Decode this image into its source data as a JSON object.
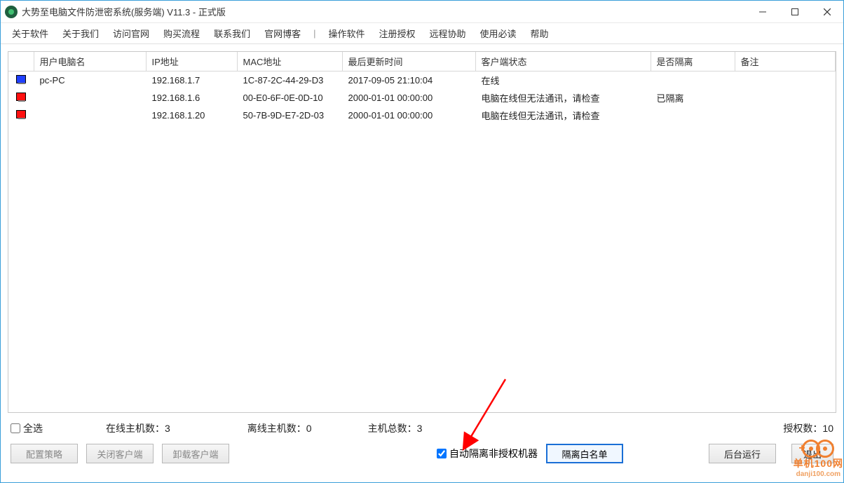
{
  "window": {
    "title": "大势至电脑文件防泄密系统(服务端) V11.3 - 正式版"
  },
  "menu": {
    "items_left": [
      "关于软件",
      "关于我们",
      "访问官网",
      "购买流程",
      "联系我们",
      "官网博客"
    ],
    "separator": "|",
    "items_right": [
      "操作软件",
      "注册授权",
      "远程协助",
      "使用必读",
      "帮助"
    ]
  },
  "table": {
    "columns": [
      "",
      "用户电脑名",
      "IP地址",
      "MAC地址",
      "最后更新时间",
      "客户端状态",
      "是否隔离",
      "备注"
    ],
    "col_widths": [
      "36px",
      "160px",
      "130px",
      "150px",
      "190px",
      "250px",
      "120px",
      "auto"
    ],
    "rows": [
      {
        "icon": "blue",
        "name": "pc-PC",
        "ip": "192.168.1.7",
        "mac": "1C-87-2C-44-29-D3",
        "time": "2017-09-05 21:10:04",
        "status": "在线",
        "iso": "",
        "remark": ""
      },
      {
        "icon": "red",
        "name": "",
        "ip": "192.168.1.6",
        "mac": "00-E0-6F-0E-0D-10",
        "time": "2000-01-01 00:00:00",
        "status": "电脑在线但无法通讯，请检查",
        "iso": "已隔离",
        "remark": ""
      },
      {
        "icon": "red",
        "name": "",
        "ip": "192.168.1.20",
        "mac": "50-7B-9D-E7-2D-03",
        "time": "2000-01-01 00:00:00",
        "status": "电脑在线但无法通讯，请检查",
        "iso": "",
        "remark": ""
      }
    ]
  },
  "stats": {
    "select_all": "全选",
    "online_label": "在线主机数：",
    "online_count": "3",
    "offline_label": "离线主机数：",
    "offline_count": "0",
    "total_label": "主机总数：",
    "total_count": "3",
    "license_label": "授权数：",
    "license_count": "10"
  },
  "buttons": {
    "config": "配置策略",
    "close_client": "关闭客户端",
    "uninstall": "卸载客户端",
    "auto_iso": "自动隔离非授权机器",
    "whitelist": "隔离白名单",
    "run_bg": "后台运行",
    "exit": "退出"
  },
  "watermark": {
    "line1": "单机100网",
    "line2": "danji100.com"
  }
}
